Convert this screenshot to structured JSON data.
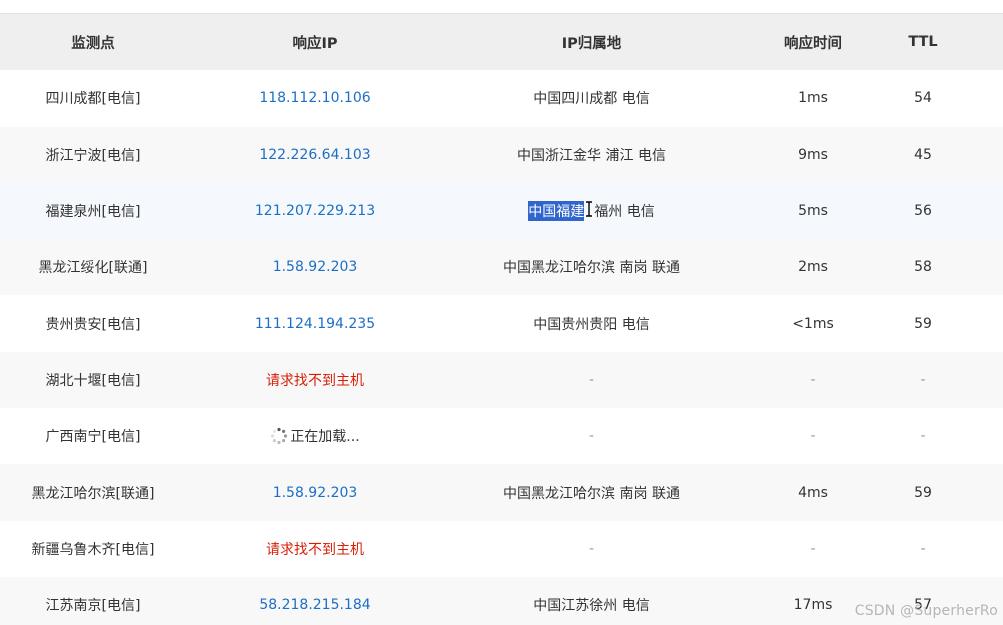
{
  "columns": {
    "site": "监测点",
    "ip": "响应IP",
    "location": "IP归属地",
    "time": "响应时间",
    "ttl": "TTL"
  },
  "rows": [
    {
      "site": "四川成都[电信]",
      "ip": "118.112.10.106",
      "location": "中国四川成都 电信",
      "time": "1ms",
      "ttl": "54"
    },
    {
      "site": "浙江宁波[电信]",
      "ip": "122.226.64.103",
      "location": "中国浙江金华 浦江 电信",
      "time": "9ms",
      "ttl": "45"
    },
    {
      "site": "福建泉州[电信]",
      "ip": "121.207.229.213",
      "location_selected": "中国福建",
      "location_rest": "福州 电信",
      "time": "5ms",
      "ttl": "56"
    },
    {
      "site": "黑龙江绥化[联通]",
      "ip": "1.58.92.203",
      "location": "中国黑龙江哈尔滨 南岗 联通",
      "time": "2ms",
      "ttl": "58"
    },
    {
      "site": "贵州贵安[电信]",
      "ip": "111.124.194.235",
      "location": "中国贵州贵阳 电信",
      "time": "<1ms",
      "ttl": "59"
    },
    {
      "site": "湖北十堰[电信]",
      "ip": "请求找不到主机",
      "location": "-",
      "time": "-",
      "ttl": "-"
    },
    {
      "site": "广西南宁[电信]",
      "ip": "正在加载...",
      "location": "-",
      "time": "-",
      "ttl": "-"
    },
    {
      "site": "黑龙江哈尔滨[联通]",
      "ip": "1.58.92.203",
      "location": "中国黑龙江哈尔滨 南岗 联通",
      "time": "4ms",
      "ttl": "59"
    },
    {
      "site": "新疆乌鲁木齐[电信]",
      "ip": "请求找不到主机",
      "location": "-",
      "time": "-",
      "ttl": "-"
    },
    {
      "site": "江苏南京[电信]",
      "ip": "58.218.215.184",
      "location": "中国江苏徐州 电信",
      "time": "17ms",
      "ttl": "57"
    }
  ],
  "icons": {
    "loading": "loading-spinner-icon",
    "cursor": "text-cursor-icon"
  },
  "watermark": "CSDN @SuperherRo",
  "colors": {
    "header_bg": "#efefef",
    "link": "#1c6fc5",
    "error": "#d81e06",
    "selection": "#2f65cc"
  }
}
